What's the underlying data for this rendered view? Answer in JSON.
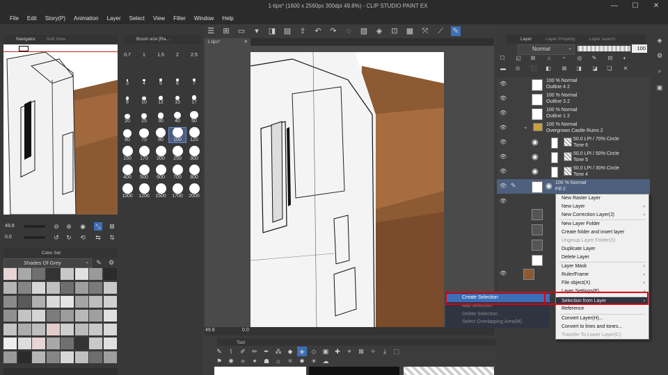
{
  "window": {
    "title": "1-tips* (1600 x 2560px 300dpi 49.8%) - CLIP STUDIO PAINT EX",
    "minimize": "—",
    "maximize": "☐",
    "close": "✕"
  },
  "menubar": [
    "File",
    "Edit",
    "Story(P)",
    "Animation",
    "Layer",
    "Select",
    "View",
    "Filter",
    "Window",
    "Help"
  ],
  "navigator": {
    "tab_navigator": "Navigator",
    "tab_subview": "Sub View",
    "zoom_value": "49.8",
    "rotate_value": "0.0"
  },
  "brush_size": {
    "tab": "Brush size [Ra...",
    "sizes": [
      "0.7",
      "1",
      "1.5",
      "2",
      "2.5",
      "3",
      "4",
      "5",
      "6",
      "7",
      "8",
      "10",
      "12",
      "15",
      "17",
      "20",
      "25",
      "30",
      "40",
      "50",
      "60",
      "70",
      "80",
      "100",
      "120",
      "150",
      "170",
      "200",
      "250",
      "300",
      "400",
      "500",
      "600",
      "700",
      "800",
      "1000",
      "1200",
      "1500",
      "1700",
      "2000"
    ],
    "selected": "100"
  },
  "color_set": {
    "tab": "Color Set",
    "set_name": "Shades Of Grey"
  },
  "canvas": {
    "tab": "1-tips*",
    "zoom_value": "49.8",
    "rotate_value": "0.0"
  },
  "tool_palette": {
    "tab": "Tool"
  },
  "layer_panel": {
    "tab_layer": "Layer",
    "tab_property": "Layer Property",
    "tab_search": "Layer search",
    "blend_mode": "Normal",
    "opacity": "100",
    "layers": [
      {
        "line1": "100 % Normal",
        "line2": "Outline 4 2"
      },
      {
        "line1": "100 % Normal",
        "line2": "Outline 3 2"
      },
      {
        "line1": "100 % Normal",
        "line2": "Outline 1 2"
      },
      {
        "line1": "100 % Normal",
        "line2": "Overgrown Castle Ruins 2"
      },
      {
        "line1": "50.0 LPI / 70% Circle",
        "line2": "Tone 6"
      },
      {
        "line1": "50.0 LPI / 50% Circle",
        "line2": "Tone 5"
      },
      {
        "line1": "50.0 LPI / 30% Circle",
        "line2": "Tone 4"
      },
      {
        "line1": "100 % Normal",
        "line2": "Fill 2"
      }
    ]
  },
  "context_menu": {
    "items": [
      {
        "label": "New Raster Layer",
        "disabled": false,
        "arrow": ""
      },
      {
        "label": "New Layer",
        "disabled": false,
        "arrow": "›"
      },
      {
        "label": "New Correction Layer(J)",
        "disabled": false,
        "arrow": "›"
      },
      {
        "label": "New Layer Folder",
        "disabled": false,
        "arrow": ""
      },
      {
        "label": "Create folder and insert layer",
        "disabled": false,
        "arrow": ""
      },
      {
        "label": "Ungroup Layer Folder(S)",
        "disabled": true,
        "arrow": ""
      },
      {
        "label": "Duplicate Layer",
        "disabled": false,
        "arrow": ""
      },
      {
        "label": "Delete Layer",
        "disabled": false,
        "arrow": ""
      },
      {
        "label": "Layer Mask",
        "disabled": false,
        "arrow": "›"
      },
      {
        "label": "Ruler/Frame",
        "disabled": false,
        "arrow": "›"
      },
      {
        "label": "File object(X)",
        "disabled": false,
        "arrow": "›"
      },
      {
        "label": "Layer Settings(P)",
        "disabled": false,
        "arrow": "›"
      },
      {
        "label": "Selection from Layer",
        "disabled": false,
        "arrow": "›"
      },
      {
        "label": "Reference",
        "disabled": false,
        "arrow": ""
      },
      {
        "label": "Convert Layer(H)...",
        "disabled": false,
        "arrow": ""
      },
      {
        "label": "Convert to lines and tones...",
        "disabled": false,
        "arrow": ""
      },
      {
        "label": "Transfer To Lower Layer(C)",
        "disabled": true,
        "arrow": ""
      }
    ]
  },
  "submenu": {
    "items": [
      {
        "label": "Create Selection",
        "disabled": false
      },
      {
        "label": "Add Selection",
        "disabled": true
      },
      {
        "label": "Delete Selection",
        "disabled": true
      },
      {
        "label": "Select Overlapping Area(M)",
        "disabled": true
      }
    ]
  },
  "colors": {
    "highlight": "#3d6fb8",
    "red_box": "#e00010"
  }
}
